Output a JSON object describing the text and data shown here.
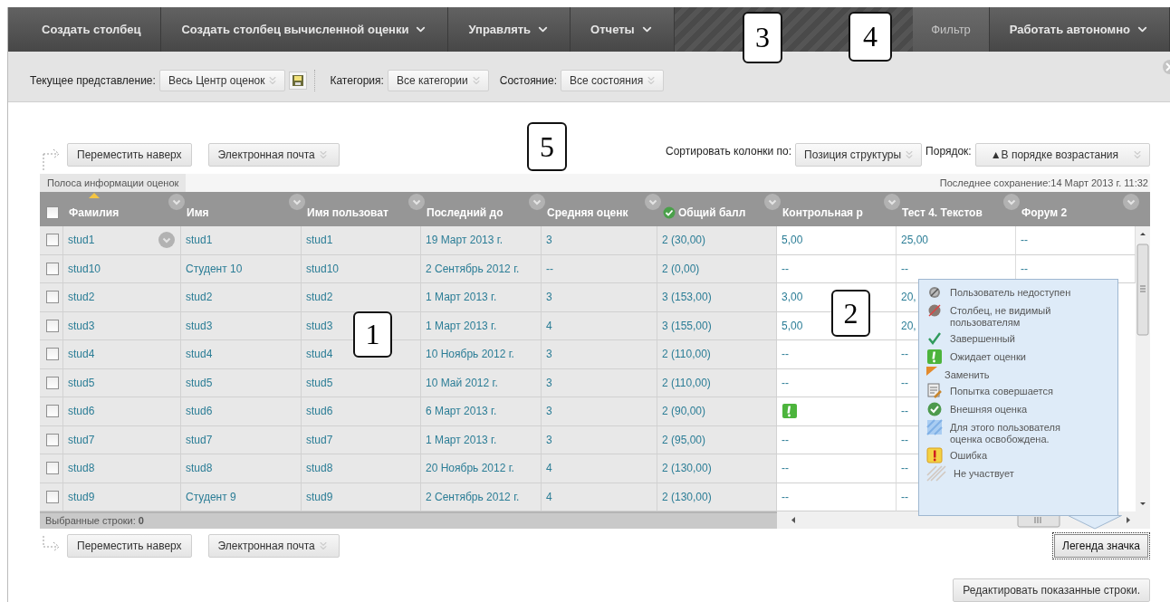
{
  "toolbar": {
    "left": [
      {
        "label": "Создать столбец",
        "dropdown": false,
        "disabled": false
      },
      {
        "label": "Создать столбец вычисленной оценки",
        "dropdown": true,
        "disabled": false
      },
      {
        "label": "Управлять",
        "dropdown": true,
        "disabled": false
      },
      {
        "label": "Отчеты",
        "dropdown": true,
        "disabled": false
      }
    ],
    "right": [
      {
        "label": "Фильтр",
        "dropdown": false,
        "disabled": true
      },
      {
        "label": "Работать автономно",
        "dropdown": true,
        "disabled": false
      }
    ]
  },
  "filter_bar": {
    "fields": [
      {
        "label": "Текущее представление:",
        "value": "Весь Центр оценок",
        "save": true
      },
      {
        "label": "Категория:",
        "value": "Все категории",
        "save": false
      },
      {
        "label": "Состояние:",
        "value": "Все состояния",
        "save": false
      }
    ]
  },
  "actions_top": {
    "buttons": [
      {
        "label": "Переместить наверх",
        "dropdown": false
      },
      {
        "label": "Электронная почта",
        "dropdown": true
      }
    ]
  },
  "sort": {
    "label": "Сортировать колонки по:",
    "value": "Позиция структуры",
    "order_label": "Порядок:",
    "order_value": "▲В порядке возрастания"
  },
  "grid": {
    "info_tab": "Полоса информации оценок",
    "last_saved": "Последнее сохранение:14 Март 2013 г. 11:32",
    "select_all": {
      "checked": false
    },
    "columns": [
      {
        "label": "Фамилия",
        "kind": "text",
        "sorted": true
      },
      {
        "label": "Имя",
        "kind": "text",
        "sorted": false
      },
      {
        "label": "Имя пользоват",
        "kind": "text",
        "sorted": false
      },
      {
        "label": "Последний до",
        "kind": "text",
        "sorted": false
      },
      {
        "label": "Средняя оценк",
        "kind": "text",
        "sorted": false
      },
      {
        "label": "Общий балл",
        "kind": "total",
        "sorted": false
      },
      {
        "label": "Контрольная р",
        "kind": "text",
        "sorted": false
      },
      {
        "label": "Тест 4. Текстов",
        "kind": "text",
        "sorted": false
      },
      {
        "label": "Форум 2",
        "kind": "text",
        "sorted": false
      }
    ],
    "rows": [
      {
        "selected": false,
        "hover": true,
        "cells": [
          "stud1",
          "stud1",
          "stud1",
          "19 Март 2013 г.",
          "3",
          "2 (30,00)",
          "5,00",
          "25,00",
          "--"
        ]
      },
      {
        "selected": false,
        "hover": false,
        "cells": [
          "stud10",
          "Студент 10",
          "stud10",
          "2 Сентябрь 2012 г.",
          "--",
          "2 (0,00)",
          "--",
          "--",
          "--"
        ]
      },
      {
        "selected": false,
        "hover": false,
        "cells": [
          "stud2",
          "stud2",
          "stud2",
          "1 Март 2013 г.",
          "3",
          "3 (153,00)",
          "3,00",
          "20,",
          null
        ]
      },
      {
        "selected": false,
        "hover": false,
        "cells": [
          "stud3",
          "stud3",
          "stud3",
          "1 Март 2013 г.",
          "4",
          "3 (155,00)",
          "5,00",
          "20,",
          null
        ]
      },
      {
        "selected": false,
        "hover": false,
        "cells": [
          "stud4",
          "stud4",
          "stud4",
          "10 Ноябрь 2012 г.",
          "3",
          "2 (110,00)",
          "--",
          "--",
          null
        ]
      },
      {
        "selected": false,
        "hover": false,
        "cells": [
          "stud5",
          "stud5",
          "stud5",
          "10 Май 2012 г.",
          "3",
          "2 (110,00)",
          "--",
          "--",
          null
        ]
      },
      {
        "selected": false,
        "hover": false,
        "cells": [
          "stud6",
          "stud6",
          "stud6",
          "6 Март 2013 г.",
          "3",
          "2 (90,00)",
          {
            "kind": "needs-grading"
          },
          "--",
          null
        ]
      },
      {
        "selected": false,
        "hover": false,
        "cells": [
          "stud7",
          "stud7",
          "stud7",
          "1 Март 2013 г.",
          "3",
          "2 (95,00)",
          "--",
          "--",
          null
        ]
      },
      {
        "selected": false,
        "hover": false,
        "cells": [
          "stud8",
          "stud8",
          "stud8",
          "20 Ноябрь 2012 г.",
          "4",
          "2 (130,00)",
          "--",
          "--",
          null
        ]
      },
      {
        "selected": false,
        "hover": false,
        "cells": [
          "stud9",
          "Студент 9",
          "stud9",
          "2 Сентябрь 2012 г.",
          "4",
          "2 (130,00)",
          "--",
          "--",
          null
        ]
      }
    ],
    "selected_rows": "Выбранные строки: **0**"
  },
  "actions_bottom": {
    "buttons": [
      {
        "label": "Переместить наверх",
        "dropdown": false
      },
      {
        "label": "Электронная почта",
        "dropdown": true
      }
    ]
  },
  "legend": {
    "button": "Легенда значка",
    "expanded": true,
    "items": [
      {
        "kind": "unavailable",
        "label": "Пользователь недоступен"
      },
      {
        "kind": "hidden",
        "label": "Столбец, не видимый пользователям"
      },
      {
        "kind": "completed",
        "label": "Завершенный"
      },
      {
        "kind": "needs-grading",
        "label": "Ожидает оценки"
      },
      {
        "kind": "override",
        "label": "Заменить"
      },
      {
        "kind": "in-progress",
        "label": "Попытка совершается"
      },
      {
        "kind": "external",
        "label": "Внешняя оценка"
      },
      {
        "kind": "exempt",
        "label": "Для этого пользователя оценка освобождена."
      },
      {
        "kind": "error",
        "label": "Ошибка"
      },
      {
        "kind": "not-participating",
        "label": "Не участвует"
      }
    ]
  },
  "edit_button": "Редактировать показанные строки.",
  "callouts": [
    "1",
    "2",
    "3",
    "4",
    "5"
  ]
}
